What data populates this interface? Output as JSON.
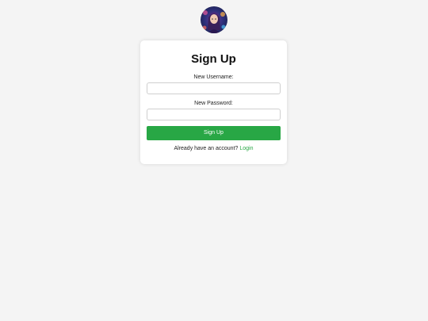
{
  "avatar": {
    "icon": "profile-avatar-image"
  },
  "signup": {
    "title": "Sign Up",
    "username_label": "New Username:",
    "username_value": "",
    "password_label": "New Password:",
    "password_value": "",
    "submit_label": "Sign Up",
    "footer_text": "Already have an account?",
    "login_link": "Login"
  },
  "colors": {
    "accent": "#28a745",
    "background": "#f4f4f4",
    "card": "#ffffff"
  }
}
